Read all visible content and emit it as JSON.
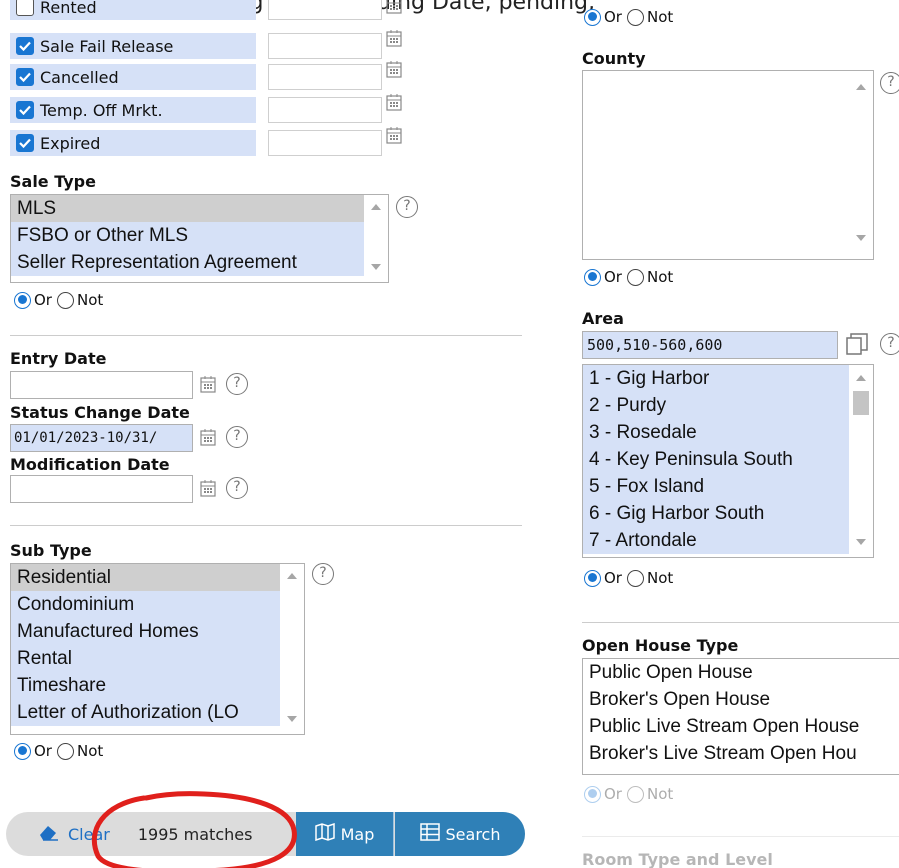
{
  "page_top": {
    "cut_text": "ing Listing Date, Pending Date, pending,"
  },
  "status_rows": [
    {
      "label": "Rented",
      "checked": false
    },
    {
      "label": "Sale Fail Release",
      "checked": true
    },
    {
      "label": "Cancelled",
      "checked": true
    },
    {
      "label": "Temp. Off Mrkt.",
      "checked": true
    },
    {
      "label": "Expired",
      "checked": true
    }
  ],
  "sale_type": {
    "heading": "Sale Type",
    "options": [
      "MLS",
      "FSBO or Other MLS",
      "Seller Representation Agreement"
    ],
    "or_label": "Or",
    "not_label": "Not"
  },
  "dates": {
    "entry_heading": "Entry Date",
    "entry_value": "",
    "status_change_heading": "Status Change Date",
    "status_change_value": "01/01/2023-10/31/",
    "modification_heading": "Modification Date",
    "modification_value": ""
  },
  "sub_type": {
    "heading": "Sub Type",
    "options": [
      "Residential",
      "Condominium",
      "Manufactured Homes",
      "Rental",
      "Timeshare",
      "Letter of Authorization (LO"
    ],
    "or_label": "Or",
    "not_label": "Not"
  },
  "right_top": {
    "or_label": "Or",
    "not_label": "Not"
  },
  "county": {
    "heading": "County",
    "or_label": "Or",
    "not_label": "Not"
  },
  "area": {
    "heading": "Area",
    "input_value": "500,510-560,600",
    "options": [
      "1 - Gig Harbor",
      "2 - Purdy",
      "3 - Rosedale",
      "4 - Key Peninsula South",
      "5 - Fox Island",
      "6 - Gig Harbor South",
      "7 - Artondale"
    ],
    "or_label": "Or",
    "not_label": "Not"
  },
  "open_house_type": {
    "heading": "Open House Type",
    "options": [
      "Public Open House",
      "Broker's Open House",
      "Public Live Stream Open House",
      "Broker's Live Stream Open Hou"
    ],
    "or_label": "Or",
    "not_label": "Not"
  },
  "room_type": {
    "heading": "Room Type and Level"
  },
  "toolbar": {
    "clear_label": "Clear",
    "matches_label": "1995 matches",
    "map_label": "Map",
    "search_label": "Search"
  },
  "colors": {
    "accent": "#1976d2",
    "selected_bg": "#d6e1f7",
    "toolbar_blue": "#2f80b7",
    "annotation_red": "#e0201c"
  },
  "help_glyph": "?"
}
